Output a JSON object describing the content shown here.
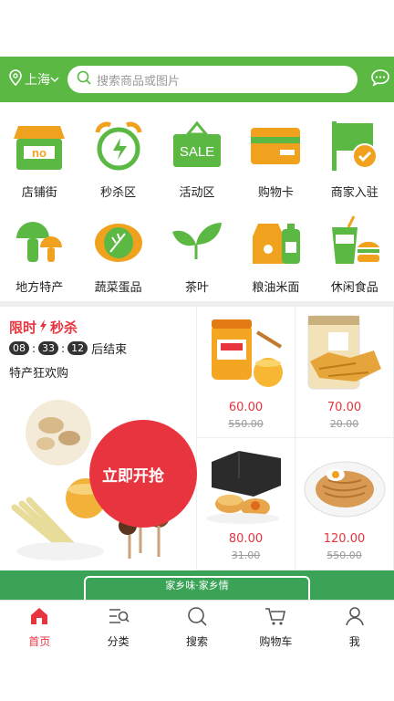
{
  "header": {
    "location": "上海",
    "search_placeholder": "搜索商品或图片"
  },
  "colors": {
    "brand_green": "#5bb843",
    "accent_red": "#e8343f",
    "icon_orange": "#f0a21e"
  },
  "categories_row1": [
    {
      "label": "店铺街",
      "icon": "shop-icon"
    },
    {
      "label": "秒杀区",
      "icon": "alarm-clock-icon"
    },
    {
      "label": "活动区",
      "icon": "sale-sign-icon"
    },
    {
      "label": "购物卡",
      "icon": "card-icon"
    },
    {
      "label": "商家入驻",
      "icon": "flag-check-icon"
    }
  ],
  "categories_row2": [
    {
      "label": "地方特产",
      "icon": "mushroom-icon"
    },
    {
      "label": "蔬菜蛋品",
      "icon": "cabbage-icon"
    },
    {
      "label": "茶叶",
      "icon": "tea-leaf-icon"
    },
    {
      "label": "粮油米面",
      "icon": "grain-oil-icon"
    },
    {
      "label": "休闲食品",
      "icon": "snack-icon"
    }
  ],
  "flash_sale": {
    "title_left": "限时",
    "title_right": "秒杀",
    "hours": "08",
    "minutes": "33",
    "seconds": "12",
    "ends_text": "后结束",
    "subtitle": "特产狂欢购",
    "button": "立即开抢"
  },
  "products": [
    {
      "price": "60.00",
      "old_price": "550.00",
      "image": "honey-jar-image"
    },
    {
      "price": "70.00",
      "old_price": "20.00",
      "image": "snack-jar-image"
    },
    {
      "price": "80.00",
      "old_price": "31.00",
      "image": "pastry-box-image"
    },
    {
      "price": "120.00",
      "old_price": "550.00",
      "image": "noodle-plate-image"
    }
  ],
  "banner": {
    "text": "家乡味·家乡情"
  },
  "tabbar": [
    {
      "label": "首页",
      "icon": "home-icon",
      "active": true
    },
    {
      "label": "分类",
      "icon": "category-icon",
      "active": false
    },
    {
      "label": "搜索",
      "icon": "search-icon",
      "active": false
    },
    {
      "label": "购物车",
      "icon": "cart-icon",
      "active": false
    },
    {
      "label": "我",
      "icon": "user-icon",
      "active": false
    }
  ]
}
